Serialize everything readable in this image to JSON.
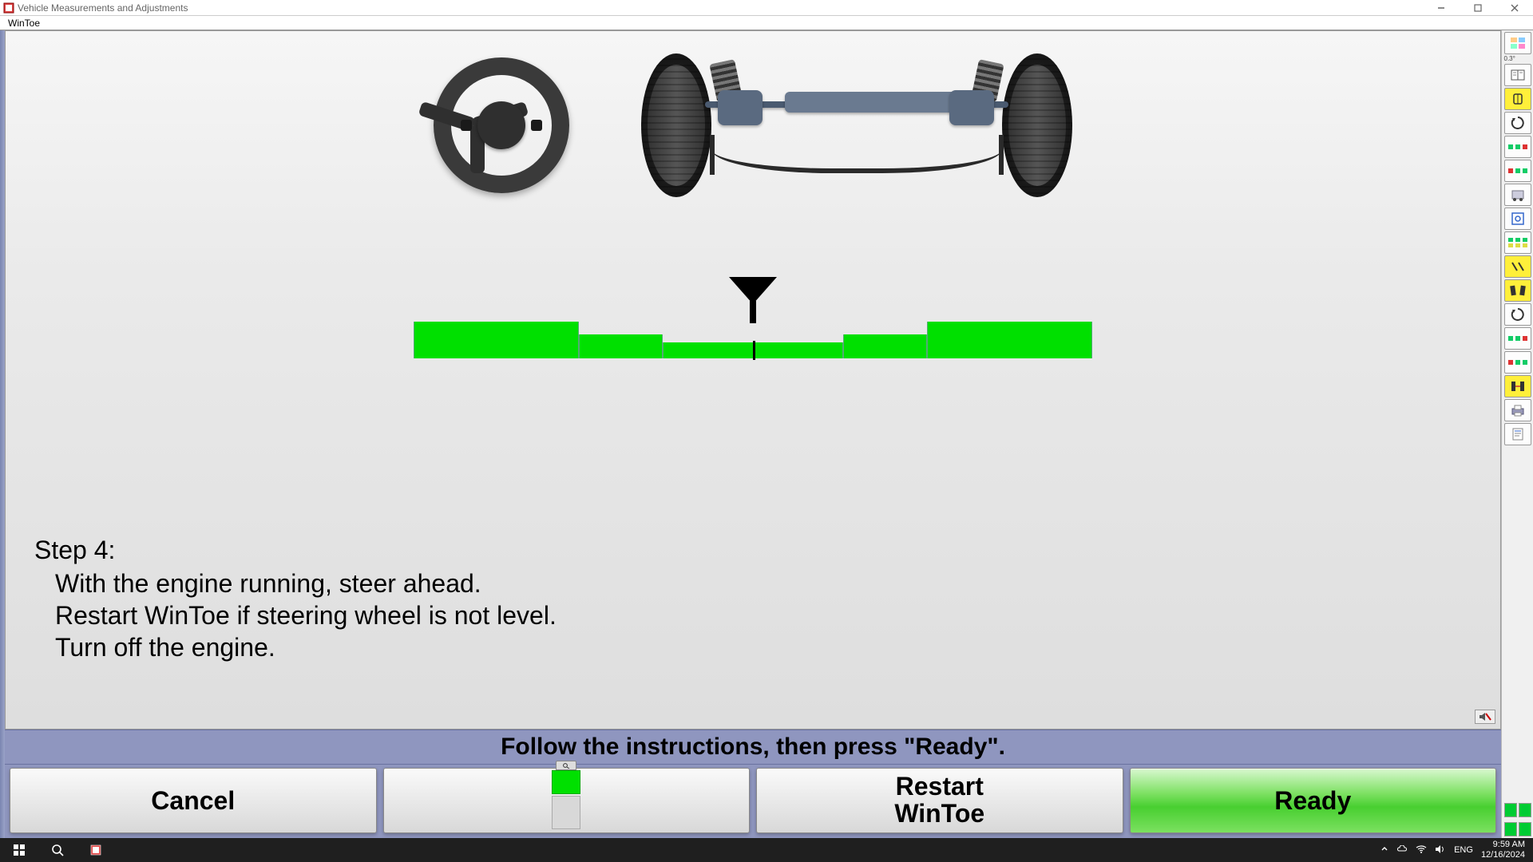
{
  "window": {
    "title": "Vehicle Measurements and Adjustments"
  },
  "menu": {
    "item1": "WinToe"
  },
  "step": {
    "heading": "Step 4:",
    "line1": "With the engine running, steer ahead.",
    "line2": "Restart WinToe if steering wheel is not level.",
    "line3": "Turn off the engine."
  },
  "prompt": "Follow the instructions, then press \"Ready\".",
  "buttons": {
    "cancel": "Cancel",
    "restart_line1": "Restart",
    "restart_line2": "WinToe",
    "ready": "Ready"
  },
  "sidebar": {
    "angle_label": "0.3°"
  },
  "taskbar": {
    "lang": "ENG",
    "time": "9:59 AM",
    "date": "12/16/2024"
  }
}
